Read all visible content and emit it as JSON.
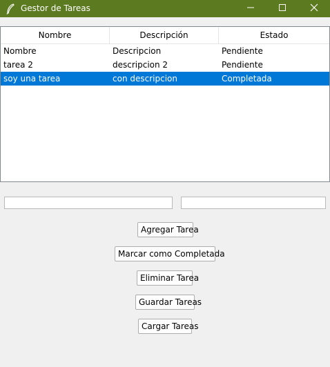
{
  "window": {
    "title": "Gestor de Tareas",
    "titlebar_color": "#5c7a1f",
    "icons": {
      "app": "feather-icon",
      "minimize": "minimize-icon",
      "maximize": "maximize-icon",
      "close": "close-icon"
    }
  },
  "table": {
    "columns": [
      "Nombre",
      "Descripción",
      "Estado"
    ],
    "rows": [
      {
        "nombre": "Nombre",
        "descripcion": "Descripcion",
        "estado": "Pendiente"
      },
      {
        "nombre": "tarea 2",
        "descripcion": "descripcion 2",
        "estado": "Pendiente"
      },
      {
        "nombre": "soy una tarea",
        "descripcion": "con descripcion",
        "estado": "Completada"
      }
    ],
    "selected_row": 2,
    "selection_color": "#0078d7"
  },
  "inputs": {
    "name_value": "",
    "description_value": ""
  },
  "buttons": {
    "add": "Agregar Tarea",
    "complete": "Marcar como Completada",
    "delete": "Eliminar Tarea",
    "save": "Guardar Tareas",
    "load": "Cargar Tareas"
  }
}
